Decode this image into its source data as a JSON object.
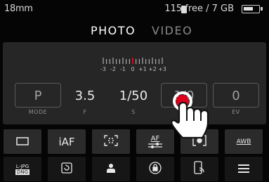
{
  "status": {
    "focal_length": "18mm",
    "storage_text": "115 free / 7 GB",
    "battery_level": 0.7
  },
  "tabs": {
    "photo": "PHOTO",
    "video": "VIDEO",
    "active": "photo"
  },
  "exposure_scale": {
    "labels": [
      "-3",
      "-2",
      "-1",
      "0",
      "+1",
      "+2",
      "+3"
    ],
    "value": 0
  },
  "params": [
    {
      "value": "P",
      "label": "MODE"
    },
    {
      "value": "3.5",
      "label": "F"
    },
    {
      "value": "1/50",
      "label": "S"
    },
    {
      "value": "1/0",
      "label": ""
    },
    {
      "value": "0",
      "label": "EV"
    }
  ],
  "buttons_row1": [
    {
      "icon": "drive-mode-single-icon"
    },
    {
      "text": "iAF",
      "icon": "autofocus-mode-icon"
    },
    {
      "icon": "af-field-icon"
    },
    {
      "text": "AF",
      "icon": "af-settings-icon"
    },
    {
      "icon": "metering-icon"
    },
    {
      "text": "AWB",
      "icon": "white-balance-icon"
    }
  ],
  "buttons_row2": [
    {
      "text": "L-JPG\nDNG",
      "icon": "file-format-icon"
    },
    {
      "icon": "self-timer-icon"
    },
    {
      "icon": "user-profile-icon"
    },
    {
      "icon": "exposure-lock-icon"
    },
    {
      "icon": "phone-connection-icon"
    },
    {
      "icon": "menu-icon"
    }
  ],
  "colors": {
    "accent": "#e0001b",
    "background": "#050505",
    "panel": "#262626"
  }
}
